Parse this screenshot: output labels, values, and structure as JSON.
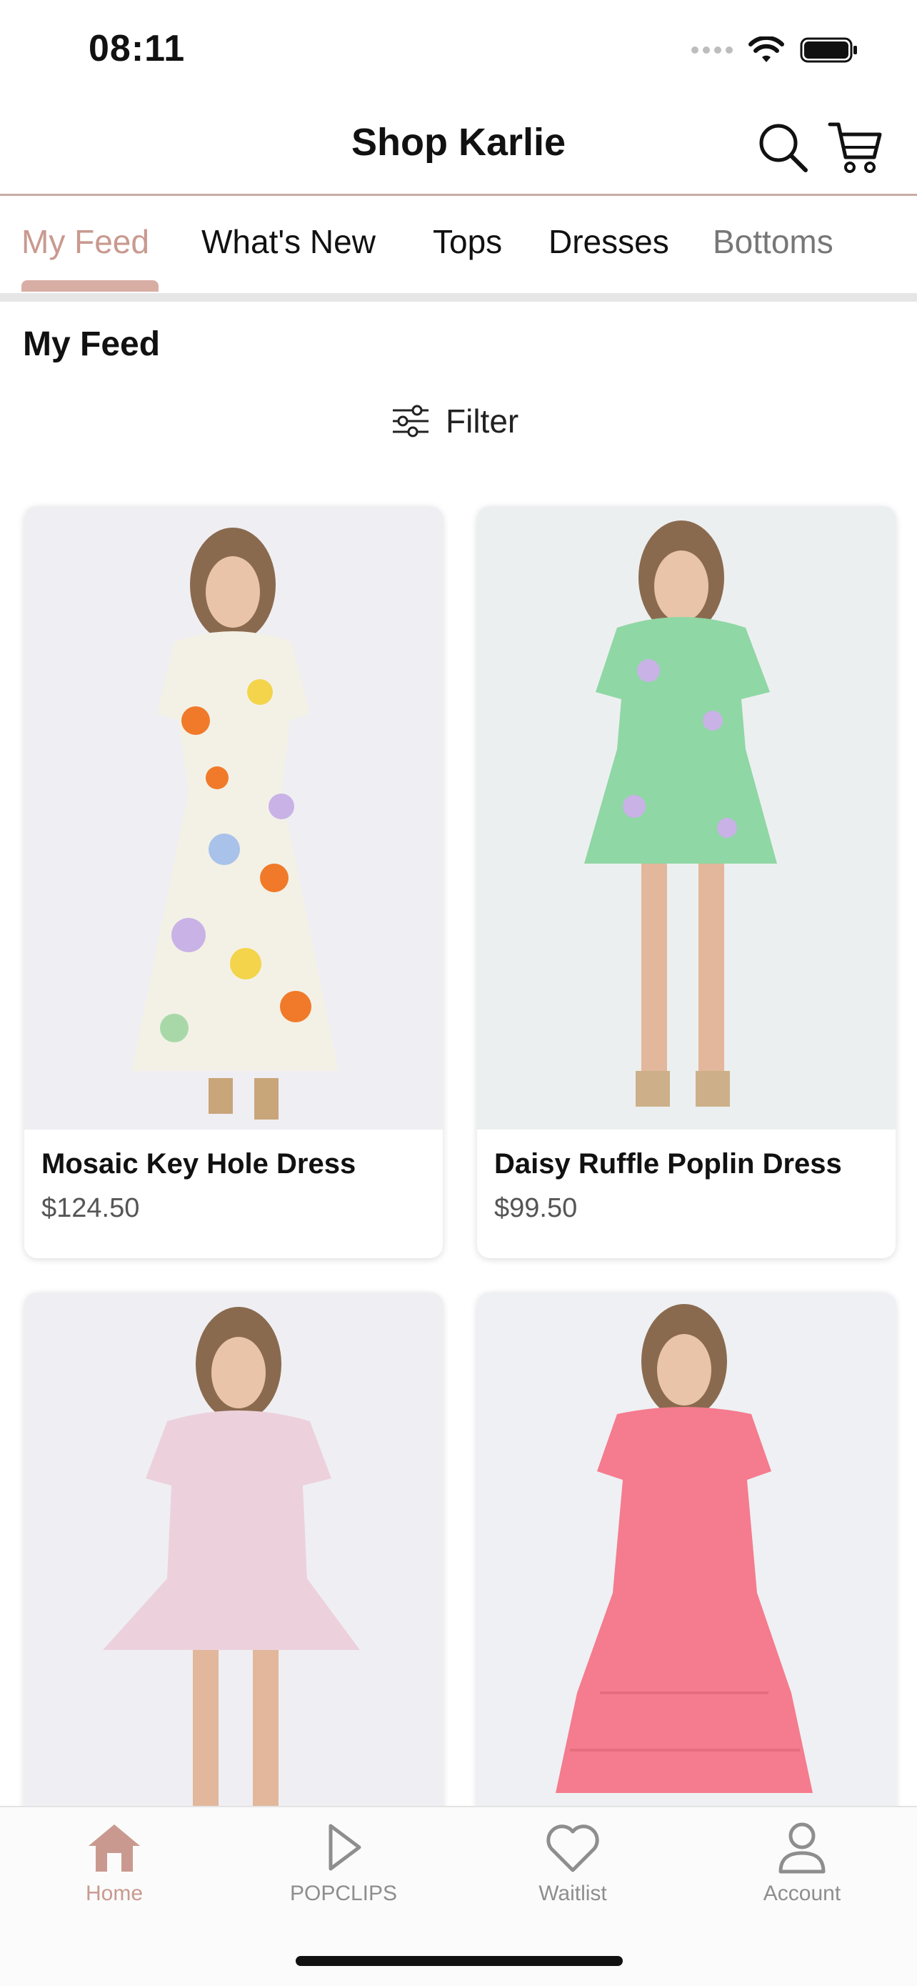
{
  "status_bar": {
    "time": "08:11"
  },
  "header": {
    "title": "Shop Karlie"
  },
  "tabs": [
    {
      "label": "My Feed",
      "active": true
    },
    {
      "label": "What's New"
    },
    {
      "label": "Tops"
    },
    {
      "label": "Dresses"
    },
    {
      "label": "Bottoms"
    }
  ],
  "feed": {
    "title": "My Feed",
    "filter_label": "Filter"
  },
  "products": [
    {
      "name": "Mosaic Key Hole Dress",
      "price": "$124.50"
    },
    {
      "name": "Daisy Ruffle Poplin Dress",
      "price": "$99.50"
    }
  ],
  "bottom_nav": [
    {
      "label": "Home",
      "icon": "home-icon",
      "active": true
    },
    {
      "label": "POPCLIPS",
      "icon": "play-icon"
    },
    {
      "label": "Waitlist",
      "icon": "heart-icon"
    },
    {
      "label": "Account",
      "icon": "person-icon"
    }
  ],
  "colors": {
    "accent": "#c9998f",
    "divider": "#c8aca2"
  }
}
